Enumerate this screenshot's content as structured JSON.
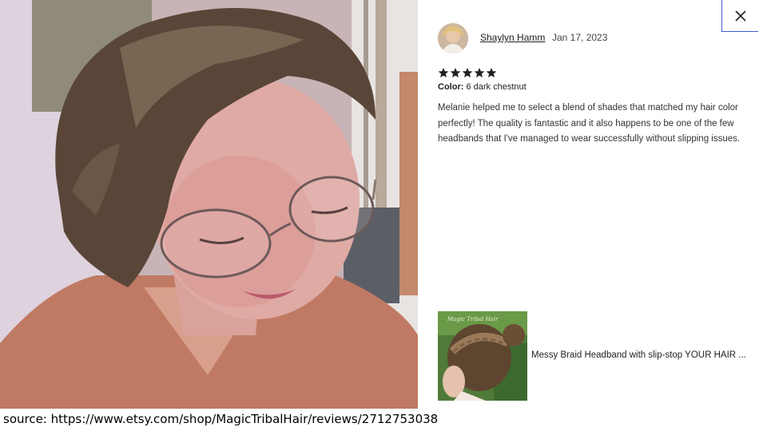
{
  "modal": {
    "close_icon": "close-icon"
  },
  "review": {
    "reviewer_name": "Shaylyn Hamm",
    "date": "Jan 17, 2023",
    "rating": 5,
    "variation_label": "Color:",
    "variation_value": "6 dark chestnut",
    "text": "Melanie helped me to select a blend of shades that matched my hair color perfectly! The quality is fantastic and it also happens to be one of the few headbands that I've managed to wear successfully without slipping issues."
  },
  "product": {
    "title": "Messy Braid Headband with slip-stop YOUR HAIR ...",
    "thumb_watermark": "Magic Tribal Hair"
  },
  "caption": {
    "source": "source: https://www.etsy.com/shop/MagicTribalHair/reviews/2712753038"
  },
  "colors": {
    "star": "#222222",
    "close_border": "#3b5fd0"
  }
}
